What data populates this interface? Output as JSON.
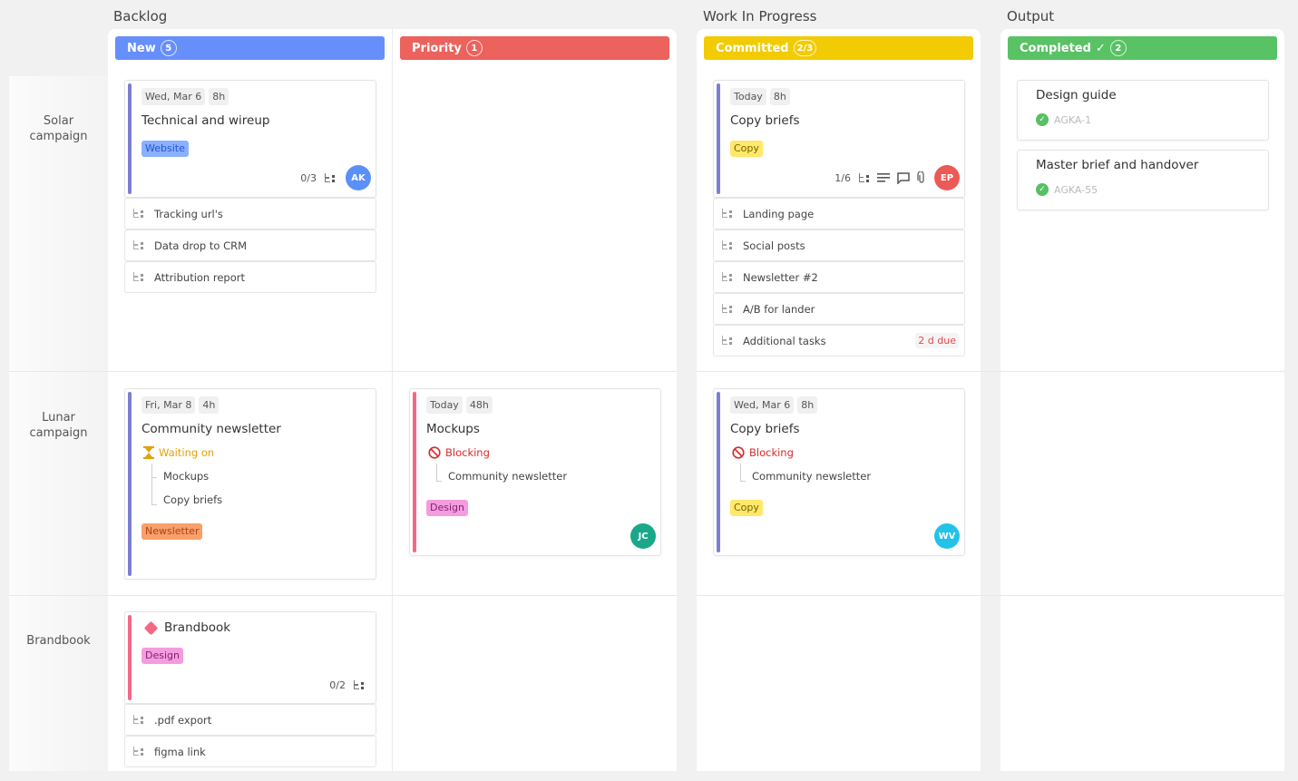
{
  "groups": [
    {
      "title": "Backlog"
    },
    {
      "title": "Work In Progress"
    },
    {
      "title": "Output"
    }
  ],
  "columns": [
    {
      "label": "New",
      "count": "5",
      "color": "#668ffc"
    },
    {
      "label": "Priority",
      "count": "1",
      "color": "#ec625d"
    },
    {
      "label": "Committed",
      "count": "2/3",
      "color": "#f2cb03"
    },
    {
      "label": "Completed",
      "check": "✓",
      "count": "2",
      "color": "#59c264"
    }
  ],
  "lanes": [
    {
      "label": "Solar campaign"
    },
    {
      "label": "Lunar campaign"
    },
    {
      "label": "Brandbook"
    }
  ],
  "cards": {
    "solar_new": {
      "date": "Wed, Mar 6",
      "estimate": "8h",
      "title": "Technical and wireup",
      "tag": "Website",
      "subtask_progress": "0/3",
      "assignee": "AK",
      "assignee_color": "#5b8ff9",
      "bar_color": "#7c7fd1",
      "subtasks": [
        "Tracking url's",
        "Data drop to CRM",
        "Attribution report"
      ]
    },
    "solar_committed": {
      "date": "Today",
      "estimate": "8h",
      "title": "Copy briefs",
      "tag": "Copy",
      "subtask_progress": "1/6",
      "assignee": "EP",
      "assignee_color": "#ec5a55",
      "bar_color": "#7c7fd1",
      "subtasks": [
        "Landing page",
        "Social posts",
        "Newsletter #2",
        "A/B for lander",
        "Additional tasks"
      ],
      "due_badge": "2 d due"
    },
    "lunar_new": {
      "date": "Fri, Mar 8",
      "estimate": "4h",
      "title": "Community newsletter",
      "status": "Waiting on",
      "dependencies": [
        "Mockups",
        "Copy briefs"
      ],
      "tag": "Newsletter",
      "bar_color": "#7c7fd1"
    },
    "lunar_priority": {
      "date": "Today",
      "estimate": "48h",
      "title": "Mockups",
      "status": "Blocking",
      "dependencies": [
        "Community newsletter"
      ],
      "tag": "Design",
      "assignee": "JC",
      "assignee_color": "#1aa88a",
      "bar_color": "#f46886"
    },
    "lunar_committed": {
      "date": "Wed, Mar 6",
      "estimate": "8h",
      "title": "Copy briefs",
      "status": "Blocking",
      "dependencies": [
        "Community newsletter"
      ],
      "tag": "Copy",
      "assignee": "WV",
      "assignee_color": "#23c2e8",
      "bar_color": "#7c7fd1"
    },
    "brand_new": {
      "title": "Brandbook",
      "tag": "Design",
      "subtask_progress": "0/2",
      "bar_color": "#f46886",
      "subtasks": [
        ".pdf export",
        "figma link"
      ]
    }
  },
  "completed": [
    {
      "title": "Design guide",
      "id": "AGKA-1"
    },
    {
      "title": "Master brief and handover",
      "id": "AGKA-55"
    }
  ]
}
